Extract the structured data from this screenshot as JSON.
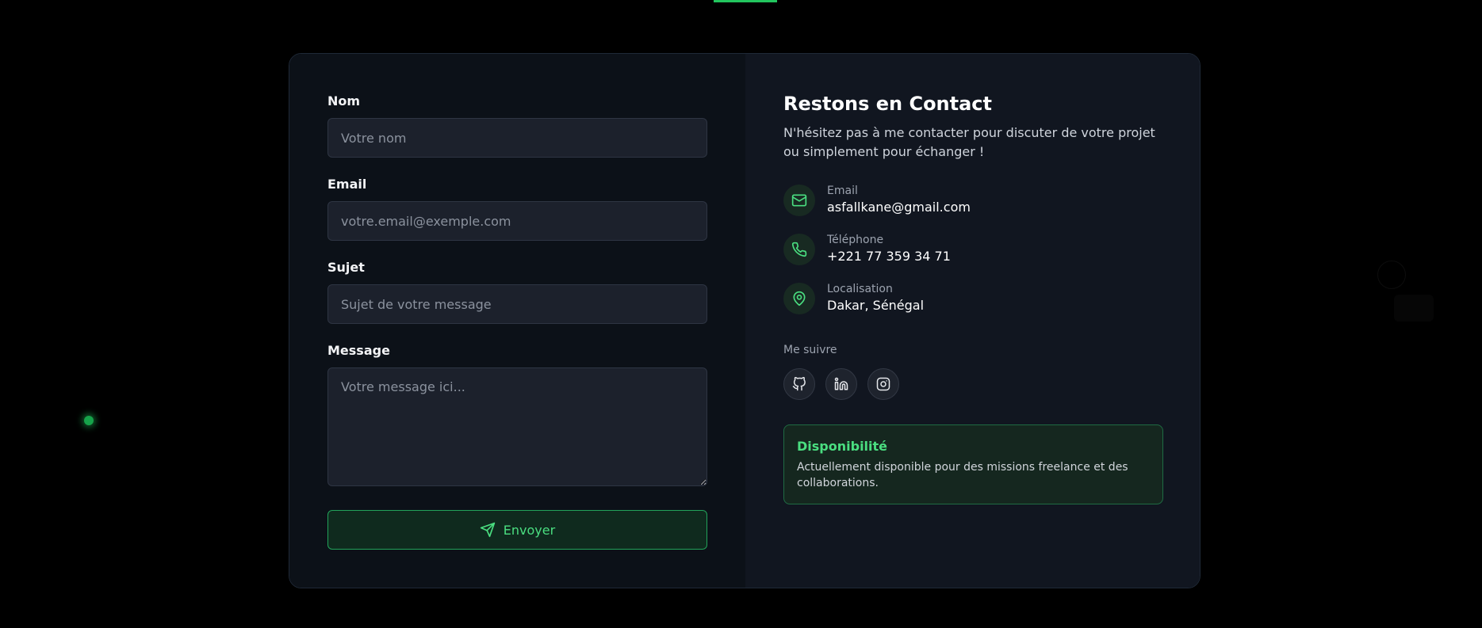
{
  "form": {
    "name": {
      "label": "Nom",
      "placeholder": "Votre nom"
    },
    "email": {
      "label": "Email",
      "placeholder": "votre.email@exemple.com"
    },
    "subject": {
      "label": "Sujet",
      "placeholder": "Sujet de votre message"
    },
    "message": {
      "label": "Message",
      "placeholder": "Votre message ici..."
    },
    "submit_label": "Envoyer",
    "submit_icon": "send-icon"
  },
  "contact": {
    "title": "Restons en Contact",
    "intro": "N'hésitez pas à me contacter pour discuter de votre projet ou simplement pour échanger !",
    "items": [
      {
        "icon": "mail-icon",
        "label": "Email",
        "value": "asfallkane@gmail.com"
      },
      {
        "icon": "phone-icon",
        "label": "Téléphone",
        "value": "+221 77 359 34 71"
      },
      {
        "icon": "map-pin-icon",
        "label": "Localisation",
        "value": "Dakar, Sénégal"
      }
    ],
    "follow_label": "Me suivre",
    "socials": [
      "github-icon",
      "linkedin-icon",
      "instagram-icon"
    ]
  },
  "availability": {
    "title": "Disponibilité",
    "text": "Actuellement disponible pour des missions freelance et des collaborations."
  },
  "colors": {
    "accent": "#4ade80",
    "accent_border": "#22a35a",
    "background": "#000000",
    "form_panel": "#0c1118",
    "info_panel": "#111620"
  }
}
